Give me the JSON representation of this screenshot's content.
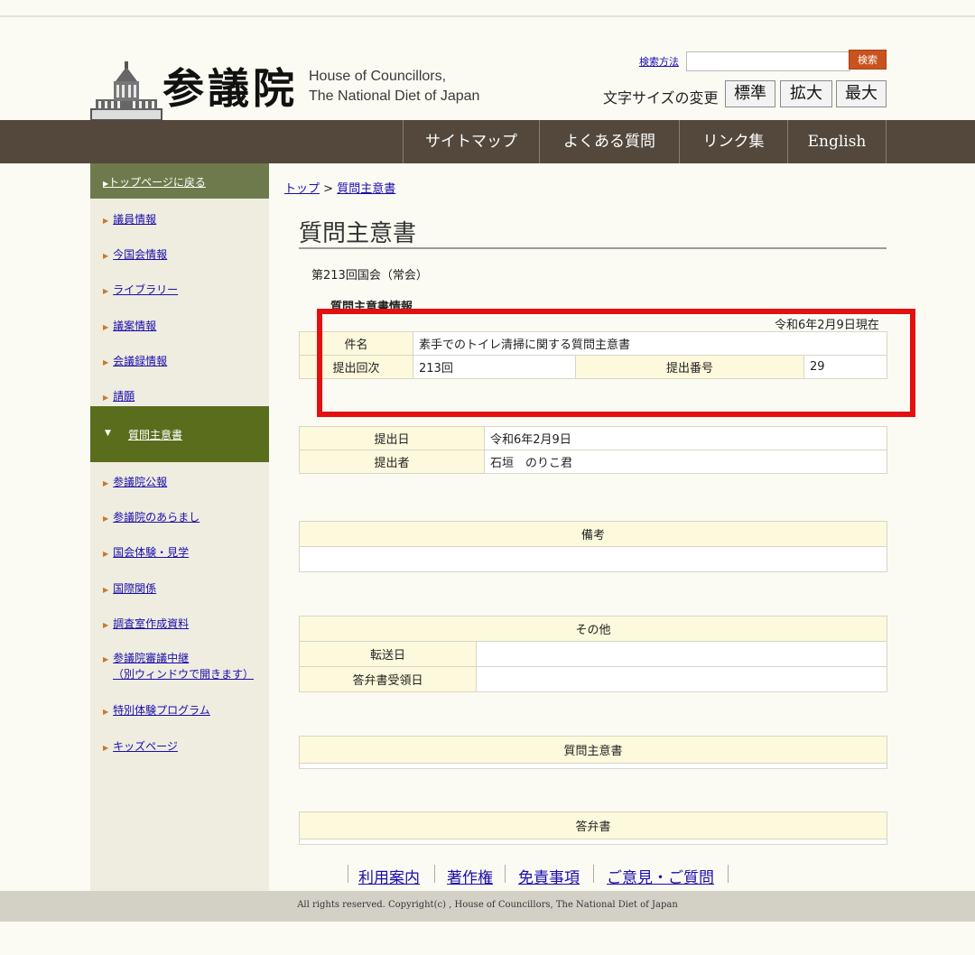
{
  "header": {
    "logo_kanji": "参議院",
    "logo_en_line1": "House of Councillors,",
    "logo_en_line2": "The National Diet of Japan",
    "search_link": "検索方法",
    "search_placeholder": "",
    "search_button": "検索",
    "font_size_label": "文字サイズの変更",
    "font_sizes": [
      "標準",
      "拡大",
      "最大"
    ]
  },
  "nav": [
    "サイトマップ",
    "よくある質問",
    "リンク集",
    "English"
  ],
  "sidebar": {
    "back": "トップページに戻る",
    "items": [
      "議員情報",
      "今国会情報",
      "ライブラリー",
      "議案情報",
      "会議録情報",
      "請願"
    ],
    "active": "質問主意書",
    "items2": [
      "参議院公報",
      "参議院のあらまし",
      "国会体験・見学",
      "国際関係",
      "調査室作成資料"
    ],
    "broadcast_line1": "参議院審議中継",
    "broadcast_line2": "（別ウィンドウで開きます）",
    "items3": [
      "特別体験プログラム",
      "キッズページ"
    ]
  },
  "breadcrumb": {
    "top": "トップ",
    "sep": ">",
    "current": "質問主意書"
  },
  "main": {
    "title": "質問主意書",
    "session": "第213回国会（常会）",
    "subhead": "質問主意書情報",
    "as_of": "令和6年2月9日現在",
    "info": {
      "subject_label": "件名",
      "subject_value": "素手でのトイレ清掃に関する質問主意書",
      "session_label": "提出回次",
      "session_value": "213回",
      "number_label": "提出番号",
      "number_value": "29"
    },
    "submission": {
      "date_label": "提出日",
      "date_value": "令和6年2月9日",
      "submitter_label": "提出者",
      "submitter_value": "石垣　のりこ君"
    },
    "remarks_header": "備考",
    "other": {
      "header": "その他",
      "transfer_label": "転送日",
      "answer_received_label": "答弁書受領日"
    },
    "question_header": "質問主意書",
    "answer_header": "答弁書"
  },
  "footer": {
    "links": [
      "利用案内",
      "著作権",
      "免責事項",
      "ご意見・ご質問"
    ],
    "copyright": "All rights reserved. Copyright(c) , House of Councillors, The National Diet of Japan"
  },
  "colors": {
    "nav_bg": "#53483b",
    "sidebar_active": "#5a6d1d",
    "table_label_bg": "#fdf9dc",
    "highlight_box": "#e41010",
    "search_button": "#c9531e"
  }
}
